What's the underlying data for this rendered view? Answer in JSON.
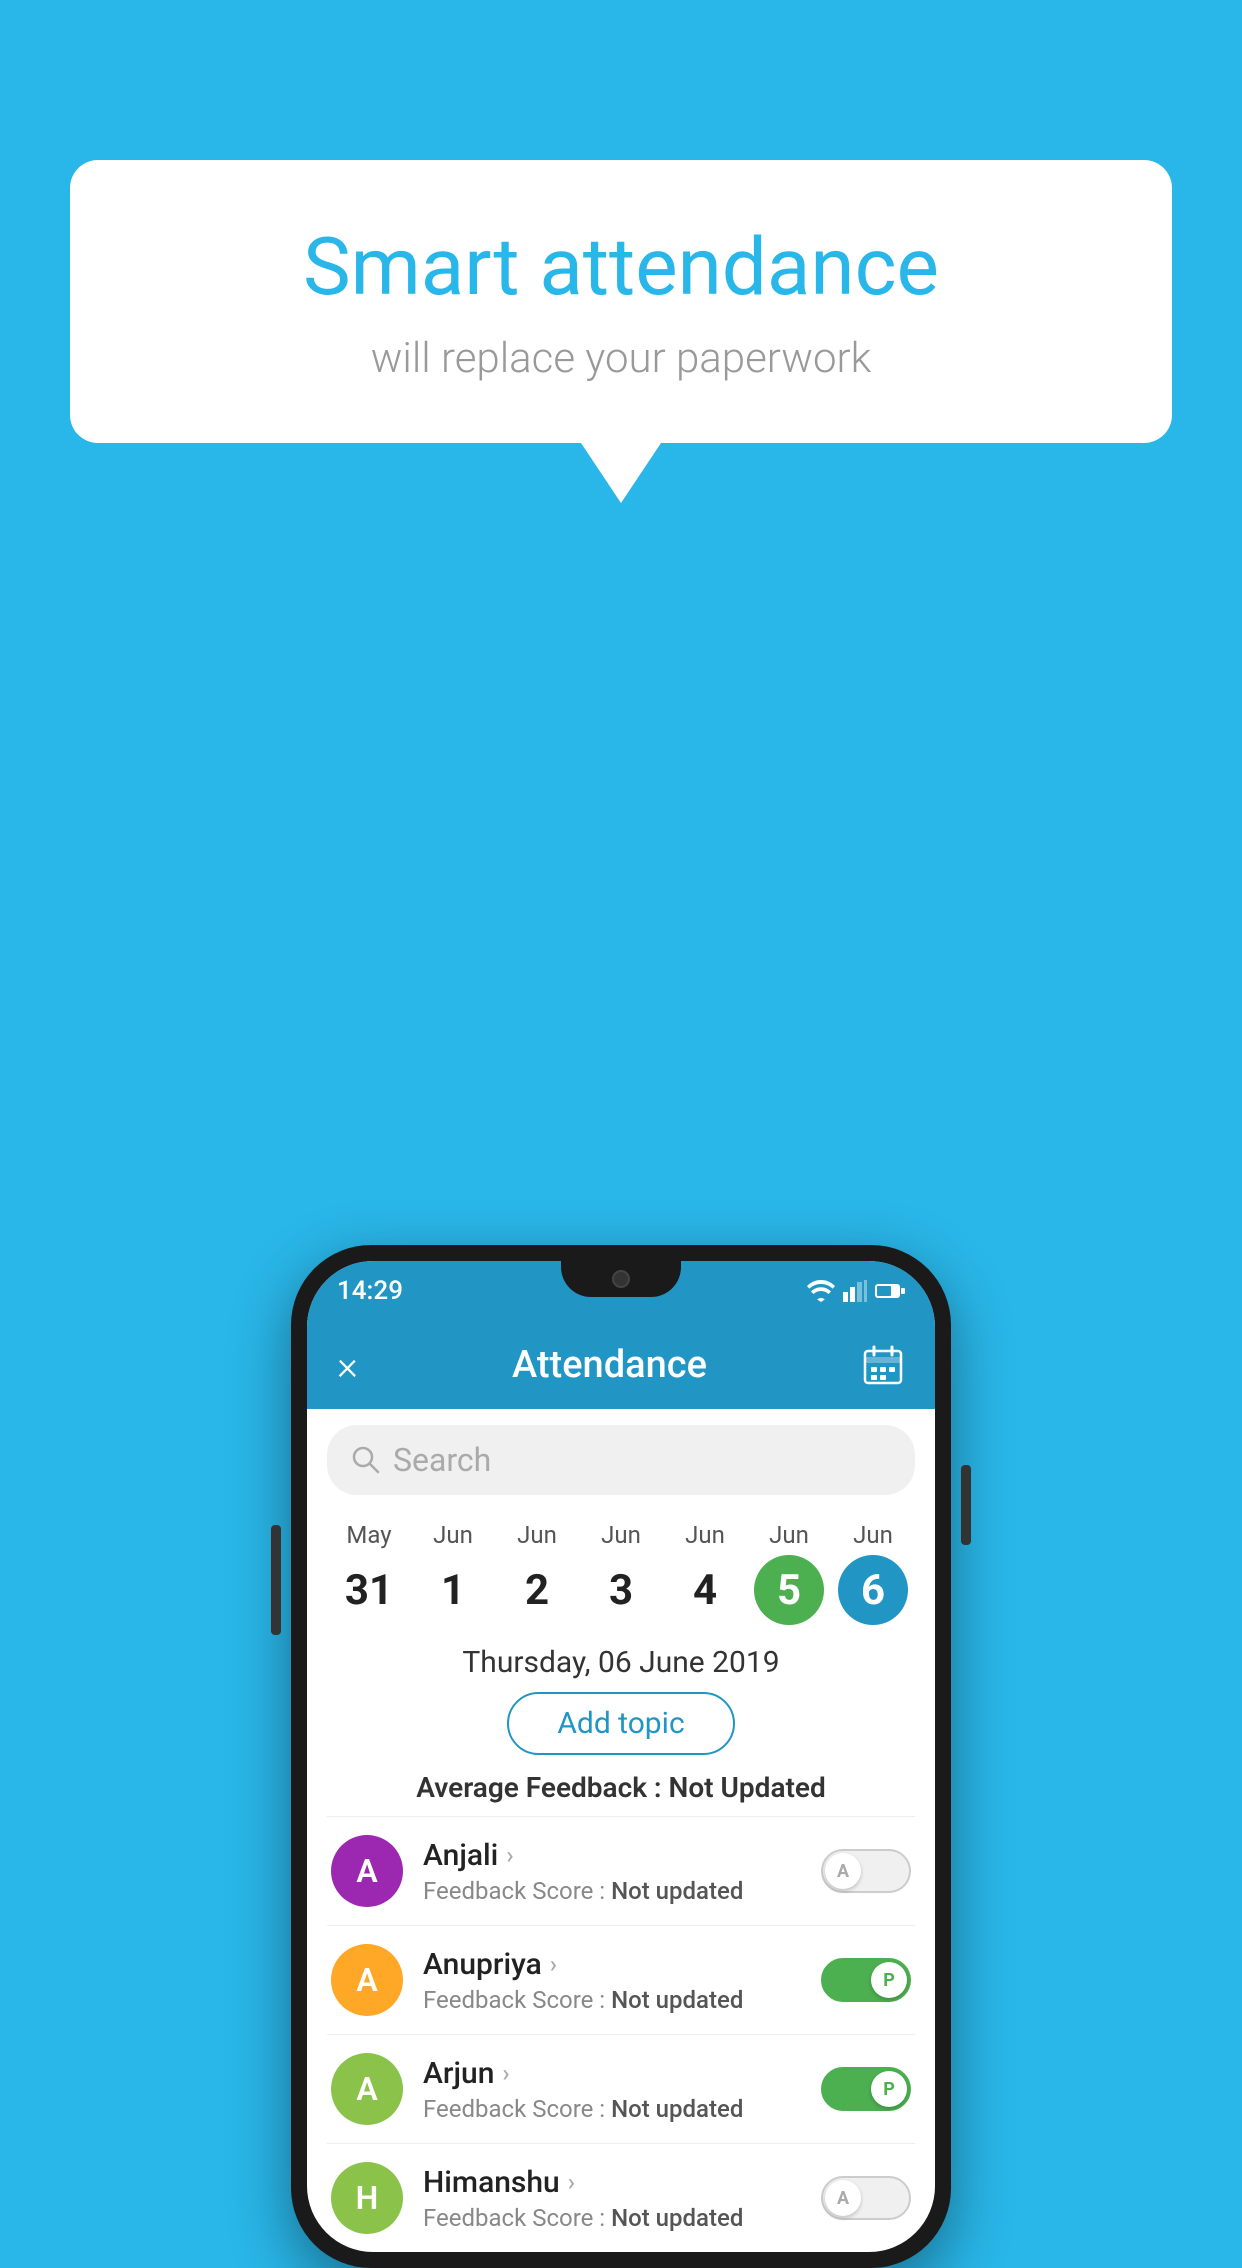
{
  "background_color": "#29B6E8",
  "speech_bubble": {
    "title": "Smart attendance",
    "subtitle": "will replace your paperwork"
  },
  "status_bar": {
    "time": "14:29"
  },
  "header": {
    "title": "Attendance",
    "close_label": "×",
    "calendar_icon": "calendar-icon"
  },
  "search": {
    "placeholder": "Search"
  },
  "calendar": {
    "days": [
      {
        "month": "May",
        "date": "31",
        "type": "normal"
      },
      {
        "month": "Jun",
        "date": "1",
        "type": "normal"
      },
      {
        "month": "Jun",
        "date": "2",
        "type": "normal"
      },
      {
        "month": "Jun",
        "date": "3",
        "type": "normal"
      },
      {
        "month": "Jun",
        "date": "4",
        "type": "normal"
      },
      {
        "month": "Jun",
        "date": "5",
        "type": "today"
      },
      {
        "month": "Jun",
        "date": "6",
        "type": "selected"
      }
    ],
    "selected_date_label": "Thursday, 06 June 2019"
  },
  "add_topic_label": "Add topic",
  "avg_feedback_label": "Average Feedback :",
  "avg_feedback_value": "Not Updated",
  "students": [
    {
      "name": "Anjali",
      "avatar_letter": "A",
      "avatar_color": "#9C27B0",
      "feedback_label": "Feedback Score :",
      "feedback_value": "Not updated",
      "toggle": "off",
      "toggle_letter": "A"
    },
    {
      "name": "Anupriya",
      "avatar_letter": "A",
      "avatar_color": "#FFA726",
      "feedback_label": "Feedback Score :",
      "feedback_value": "Not updated",
      "toggle": "on",
      "toggle_letter": "P"
    },
    {
      "name": "Arjun",
      "avatar_letter": "A",
      "avatar_color": "#8BC34A",
      "feedback_label": "Feedback Score :",
      "feedback_value": "Not updated",
      "toggle": "on",
      "toggle_letter": "P"
    },
    {
      "name": "Himanshu",
      "avatar_letter": "H",
      "avatar_color": "#8BC34A",
      "feedback_label": "Feedback Score :",
      "feedback_value": "Not updated",
      "toggle": "off",
      "toggle_letter": "A"
    }
  ]
}
